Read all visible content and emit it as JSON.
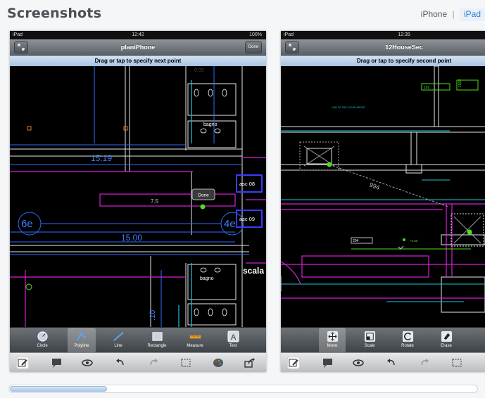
{
  "page": {
    "title": "Screenshots",
    "tabs": [
      {
        "label": "iPhone"
      },
      {
        "label": "iPad"
      }
    ],
    "tab_separator": "|",
    "active_tab": "iPad"
  },
  "screenshots": [
    {
      "status": {
        "carrier": "iPad",
        "time": "12:42",
        "battery": "100%"
      },
      "nav_title": "planiPhone",
      "done_label": "Done",
      "prompt": "Drag or tap to specify next point",
      "drawing_labels": {
        "bagno_top": "bagno",
        "bagno_bottom": "bagno",
        "dim_1519": "15.19",
        "dim_1500": "15.00",
        "dim_75": "7.5",
        "grid_6e": "6e",
        "grid_4e": "4e",
        "asc08": "asc 08",
        "asc09": "asc 09",
        "scala": "scala",
        "dim_10": ".10",
        "done_bubble": "Done",
        "top_dim": "0.05"
      },
      "tools": [
        {
          "label": "Circle",
          "icon": "circle-tool-icon"
        },
        {
          "label": "Polyline",
          "icon": "polyline-tool-icon",
          "active": true
        },
        {
          "label": "Line",
          "icon": "line-tool-icon"
        },
        {
          "label": "Rectangle",
          "icon": "rectangle-tool-icon"
        },
        {
          "label": "Measure",
          "icon": "measure-tool-icon"
        },
        {
          "label": "Text",
          "icon": "text-tool-icon"
        }
      ],
      "bottom_icons": [
        "draw-mode-icon",
        "comment-icon",
        "eye-icon",
        "undo-icon",
        "redo-icon",
        "selection-icon",
        "palette-icon",
        "share-icon"
      ]
    },
    {
      "status": {
        "carrier": "iPad",
        "time": "12:35"
      },
      "nav_title": "12HouseSec",
      "prompt": "Drag or tap to specify second point",
      "drawing_labels": {
        "dim_994": "994",
        "dim_101": "101",
        "dim_204": "204",
        "note": "LINE OF 2ND FLOOR ABOVE",
        "dim_plus": "+0.60",
        "dim_1500v": "1500"
      },
      "tools": [
        {
          "label": "Move",
          "icon": "move-tool-icon",
          "active": true
        },
        {
          "label": "Scale",
          "icon": "scale-tool-icon"
        },
        {
          "label": "Rotate",
          "icon": "rotate-tool-icon"
        },
        {
          "label": "Erase",
          "icon": "erase-tool-icon"
        }
      ],
      "bottom_icons": [
        "draw-mode-icon",
        "comment-icon",
        "eye-icon",
        "undo-icon",
        "redo-icon",
        "selection-icon"
      ]
    }
  ],
  "colors": {
    "accent": "#2b7bd0",
    "cad_blue": "#2f6cff",
    "cad_magenta": "#d81fd8",
    "cad_white": "#ffffff",
    "cad_green": "#4ce01a"
  }
}
